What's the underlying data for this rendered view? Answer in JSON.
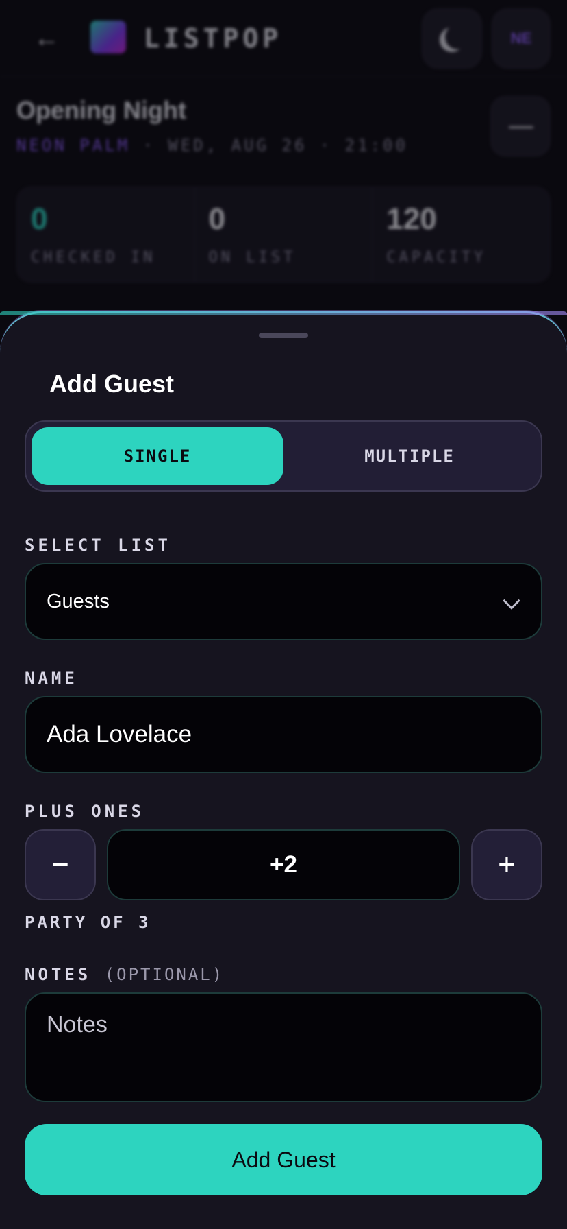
{
  "topbar": {
    "back_icon": "arrow-left-icon",
    "logo_icon": "listpop-logo-icon",
    "app_name": "LISTPOP",
    "theme_icon": "moon-icon",
    "avatar_initials": "NE"
  },
  "event": {
    "title": "Opening Night",
    "venue": "NEON PALM",
    "meta": " · WED, AUG 26 · 21:00"
  },
  "stats": [
    {
      "value": "0",
      "label": "CHECKED IN"
    },
    {
      "value": "0",
      "label": "ON LIST"
    },
    {
      "value": "120",
      "label": "CAPACITY"
    }
  ],
  "sheet": {
    "title": "Add Guest",
    "modes": [
      "SINGLE",
      "MULTIPLE"
    ],
    "active_mode": "SINGLE",
    "select_list_label": "SELECT LIST",
    "select_list_value": "Guests",
    "name_label": "NAME",
    "name_value": "Ada Lovelace",
    "plus_ones_label": "PLUS ONES",
    "plus_ones_value": "+2",
    "minus_symbol": "−",
    "plus_symbol": "+",
    "party_text": "PARTY OF 3",
    "notes_label": "NOTES",
    "notes_optional": "(OPTIONAL)",
    "notes_placeholder": "Notes",
    "submit_label": "Add Guest"
  },
  "colors": {
    "accent": "#2dd4bf",
    "purple": "#8b5cf6",
    "sheet_bg": "#16141f",
    "input_bg": "#040307"
  }
}
